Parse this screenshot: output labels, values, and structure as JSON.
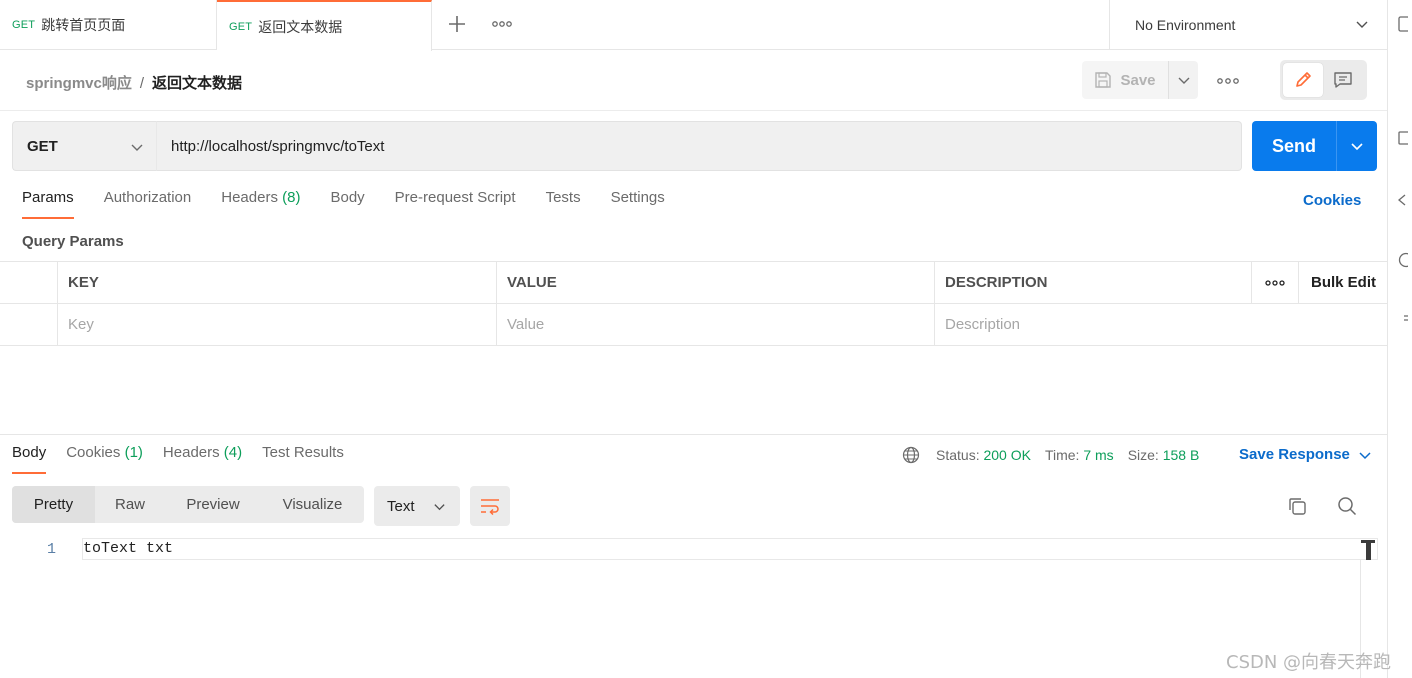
{
  "tabs": [
    {
      "method": "GET",
      "label": "跳转首页页面"
    },
    {
      "method": "GET",
      "label": "返回文本数据"
    }
  ],
  "environment": {
    "label": "No Environment"
  },
  "breadcrumb": {
    "parent": "springmvc响应",
    "separator": "/",
    "current": "返回文本数据"
  },
  "toolbar": {
    "save_label": "Save"
  },
  "request": {
    "method": "GET",
    "url": "http://localhost/springmvc/toText",
    "send_label": "Send"
  },
  "request_tabs": [
    {
      "label": "Params"
    },
    {
      "label": "Authorization"
    },
    {
      "label": "Headers",
      "count": "(8)"
    },
    {
      "label": "Body"
    },
    {
      "label": "Pre-request Script"
    },
    {
      "label": "Tests"
    },
    {
      "label": "Settings"
    }
  ],
  "cookies_link": "Cookies",
  "query_params": {
    "title": "Query Params",
    "columns": {
      "key": "KEY",
      "value": "VALUE",
      "description": "DESCRIPTION",
      "bulk_edit": "Bulk Edit"
    },
    "placeholders": {
      "key": "Key",
      "value": "Value",
      "description": "Description"
    }
  },
  "response": {
    "tabs": [
      {
        "label": "Body"
      },
      {
        "label": "Cookies",
        "count": "(1)"
      },
      {
        "label": "Headers",
        "count": "(4)"
      },
      {
        "label": "Test Results"
      }
    ],
    "status_label": "Status:",
    "status_value": "200 OK",
    "time_label": "Time:",
    "time_value": "7 ms",
    "size_label": "Size:",
    "size_value": "158 B",
    "save_response": "Save Response",
    "formats": [
      "Pretty",
      "Raw",
      "Preview",
      "Visualize"
    ],
    "language": "Text",
    "lines": [
      {
        "number": "1",
        "text": "toText txt"
      }
    ]
  },
  "watermark": "CSDN @向春天奔跑",
  "colors": {
    "accent": "#ff6c37",
    "send": "#097bed",
    "link": "#0b6bcb",
    "success": "#0d9e5a"
  },
  "icons": [
    "plus-icon",
    "more-icon",
    "chevron-down-icon",
    "save-icon",
    "pencil-icon",
    "comment-icon",
    "globe-icon",
    "copy-icon",
    "search-icon",
    "wrap-lines-icon"
  ]
}
